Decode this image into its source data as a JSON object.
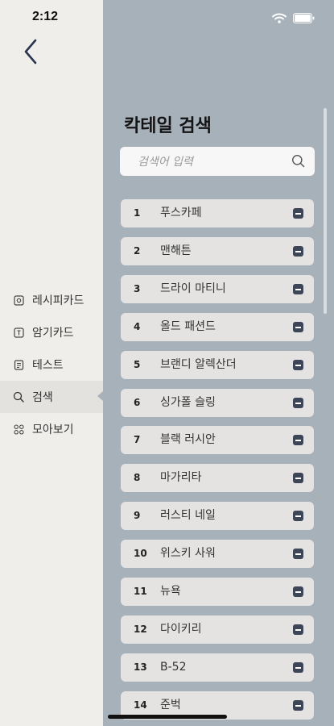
{
  "status": {
    "time": "2:12"
  },
  "sidebar": {
    "items": [
      {
        "label": "레시피카드",
        "icon": "recipe-card-icon"
      },
      {
        "label": "암기카드",
        "icon": "flashcard-icon"
      },
      {
        "label": "테스트",
        "icon": "test-icon"
      },
      {
        "label": "검색",
        "icon": "search-icon",
        "active": true
      },
      {
        "label": "모아보기",
        "icon": "grid-icon"
      }
    ]
  },
  "main": {
    "title": "칵테일 검색",
    "search": {
      "placeholder": "검색어 입력",
      "value": ""
    },
    "cocktails": [
      {
        "num": "1",
        "name": "푸스카페"
      },
      {
        "num": "2",
        "name": "맨해튼"
      },
      {
        "num": "3",
        "name": "드라이 마티니"
      },
      {
        "num": "4",
        "name": "올드 패션드"
      },
      {
        "num": "5",
        "name": "브랜디 알렉산더"
      },
      {
        "num": "6",
        "name": "싱가폴 슬링"
      },
      {
        "num": "7",
        "name": "블랙 러시안"
      },
      {
        "num": "8",
        "name": "마가리타"
      },
      {
        "num": "9",
        "name": "러스티 네일"
      },
      {
        "num": "10",
        "name": "위스키 사워"
      },
      {
        "num": "11",
        "name": "뉴욕"
      },
      {
        "num": "12",
        "name": "다이키리"
      },
      {
        "num": "13",
        "name": "B-52"
      },
      {
        "num": "14",
        "name": "준벅"
      }
    ]
  },
  "colors": {
    "main_bg": "#a7b1ba",
    "sidebar_bg": "#f0eeeb",
    "remove_icon": "#3c4656"
  }
}
